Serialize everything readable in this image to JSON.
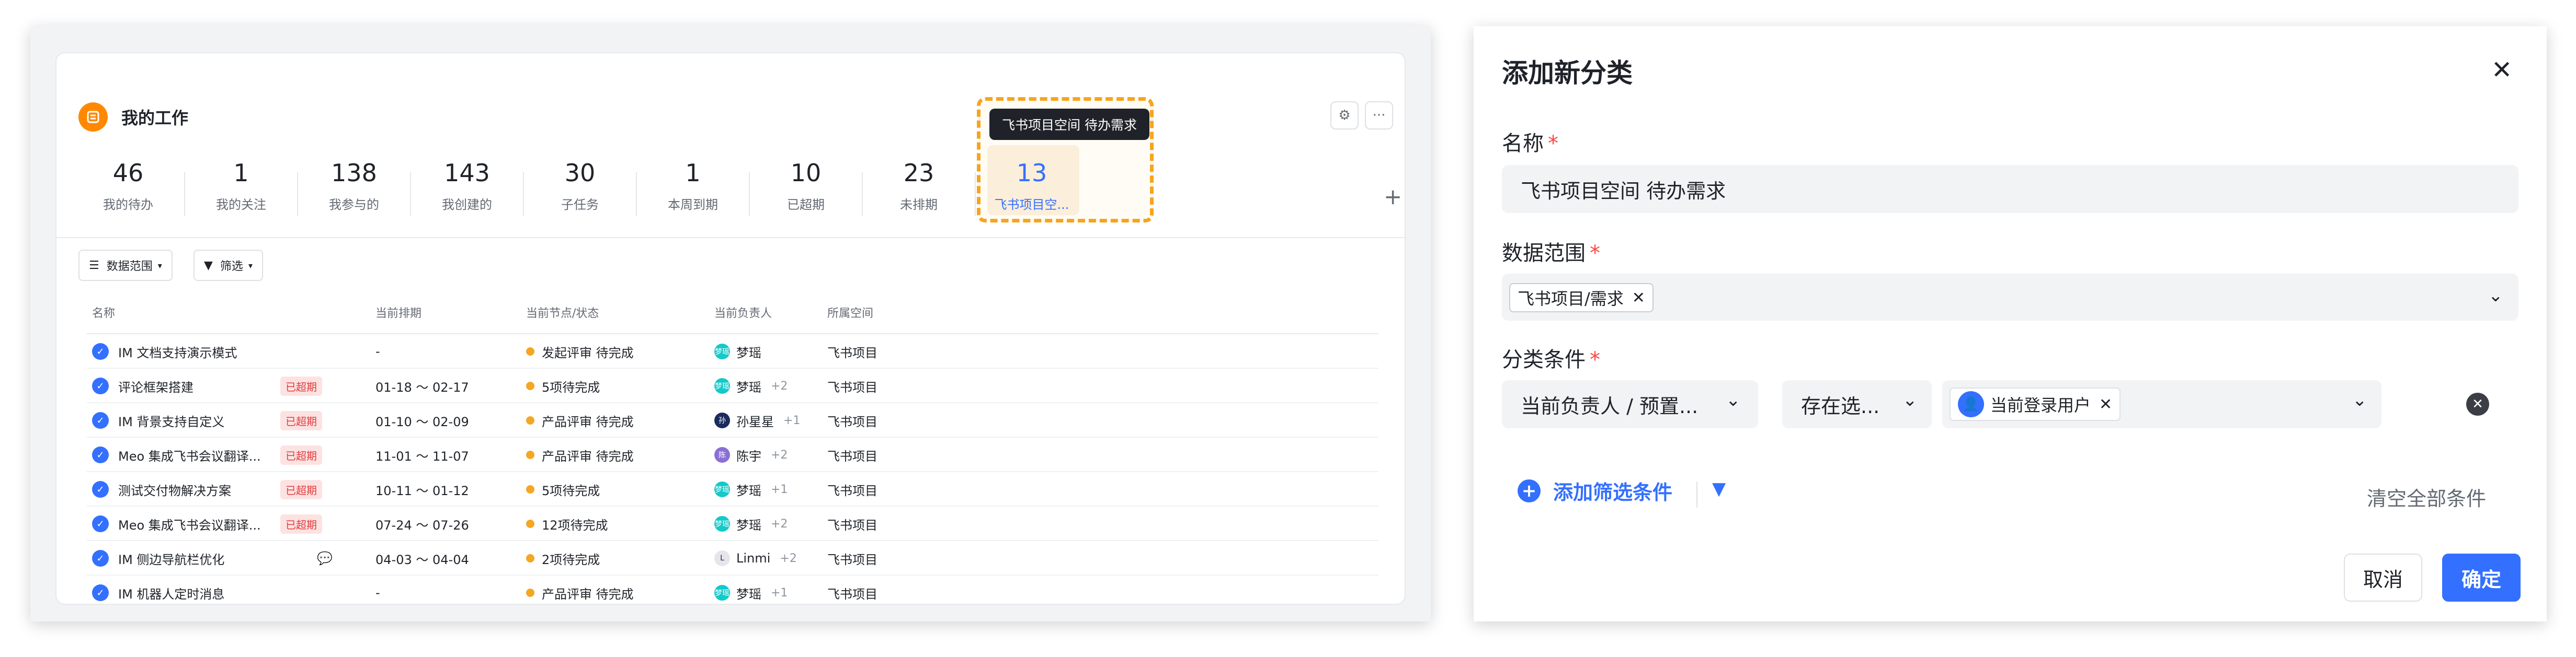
{
  "left_panel": {
    "title": "我的工作",
    "stats": [
      {
        "value": "46",
        "label": "我的待办"
      },
      {
        "value": "1",
        "label": "我的关注"
      },
      {
        "value": "138",
        "label": "我参与的"
      },
      {
        "value": "143",
        "label": "我创建的"
      },
      {
        "value": "30",
        "label": "子任务"
      },
      {
        "value": "1",
        "label": "本周到期"
      },
      {
        "value": "10",
        "label": "已超期"
      },
      {
        "value": "23",
        "label": "未排期"
      },
      {
        "value": "13",
        "label": "飞书项目空..."
      }
    ],
    "tooltip": "飞书项目空间 待办需求",
    "add_button": "+",
    "filters": {
      "data_scope": "数据范围",
      "filter": "筛选"
    },
    "columns": [
      "名称",
      "当前排期",
      "当前节点/状态",
      "当前负责人",
      "所属空间"
    ],
    "rows": [
      {
        "name": "IM 文档支持演示模式",
        "overdue": "",
        "schedule": "-",
        "status": "发起评审 待完成",
        "owner": "梦瑶",
        "owner_initial": "梦瑶",
        "extra": "",
        "space": "飞书项目",
        "comment": false
      },
      {
        "name": "评论框架搭建",
        "overdue": "已超期",
        "schedule": "01-18 ～ 02-17",
        "status": "5项待完成",
        "owner": "梦瑶",
        "owner_initial": "梦瑶",
        "extra": "+2",
        "space": "飞书项目",
        "comment": false
      },
      {
        "name": "IM 背景支持自定义",
        "overdue": "已超期",
        "schedule": "01-10 ～ 02-09",
        "status": "产品评审 待完成",
        "owner": "孙星星",
        "owner_initial": "孙",
        "extra": "+1",
        "space": "飞书项目",
        "comment": false
      },
      {
        "name": "Meo 集成飞书会议翻译...",
        "overdue": "已超期",
        "schedule": "11-01 ～ 11-07",
        "status": "产品评审 待完成",
        "owner": "陈宇",
        "owner_initial": "陈",
        "extra": "+2",
        "space": "飞书项目",
        "comment": false
      },
      {
        "name": "测试交付物解决方案",
        "overdue": "已超期",
        "schedule": "10-11 ～ 01-12",
        "status": "5项待完成",
        "owner": "梦瑶",
        "owner_initial": "梦瑶",
        "extra": "+1",
        "space": "飞书项目",
        "comment": false
      },
      {
        "name": "Meo 集成飞书会议翻译...",
        "overdue": "已超期",
        "schedule": "07-24 ～ 07-26",
        "status": "12项待完成",
        "owner": "梦瑶",
        "owner_initial": "梦瑶",
        "extra": "+2",
        "space": "飞书项目",
        "comment": false
      },
      {
        "name": "IM 侧边导航栏优化",
        "overdue": "",
        "schedule": "04-03 ～ 04-04",
        "status": "2项待完成",
        "owner": "Linmi",
        "owner_initial": "L",
        "extra": "+2",
        "space": "飞书项目",
        "comment": true
      },
      {
        "name": "IM 机器人定时消息",
        "overdue": "",
        "schedule": "-",
        "status": "产品评审 待完成",
        "owner": "梦瑶",
        "owner_initial": "梦瑶",
        "extra": "+1",
        "space": "飞书项目",
        "comment": false
      }
    ]
  },
  "dialog": {
    "title": "添加新分类",
    "name_label": "名称",
    "name_value": "飞书项目空间 待办需求",
    "scope_label": "数据范围",
    "scope_tag": "飞书项目/需求",
    "condition_label": "分类条件",
    "condition_field": "当前负责人 / 预置...",
    "condition_operator": "存在选...",
    "condition_value": "当前登录用户",
    "add_filter": "添加筛选条件",
    "clear_all": "清空全部条件",
    "cancel": "取消",
    "confirm": "确定"
  },
  "colors": {
    "accent": "#3370ff",
    "highlight": "#f7a41d",
    "overdue": "#e03e3e",
    "required": "#f54a45"
  }
}
